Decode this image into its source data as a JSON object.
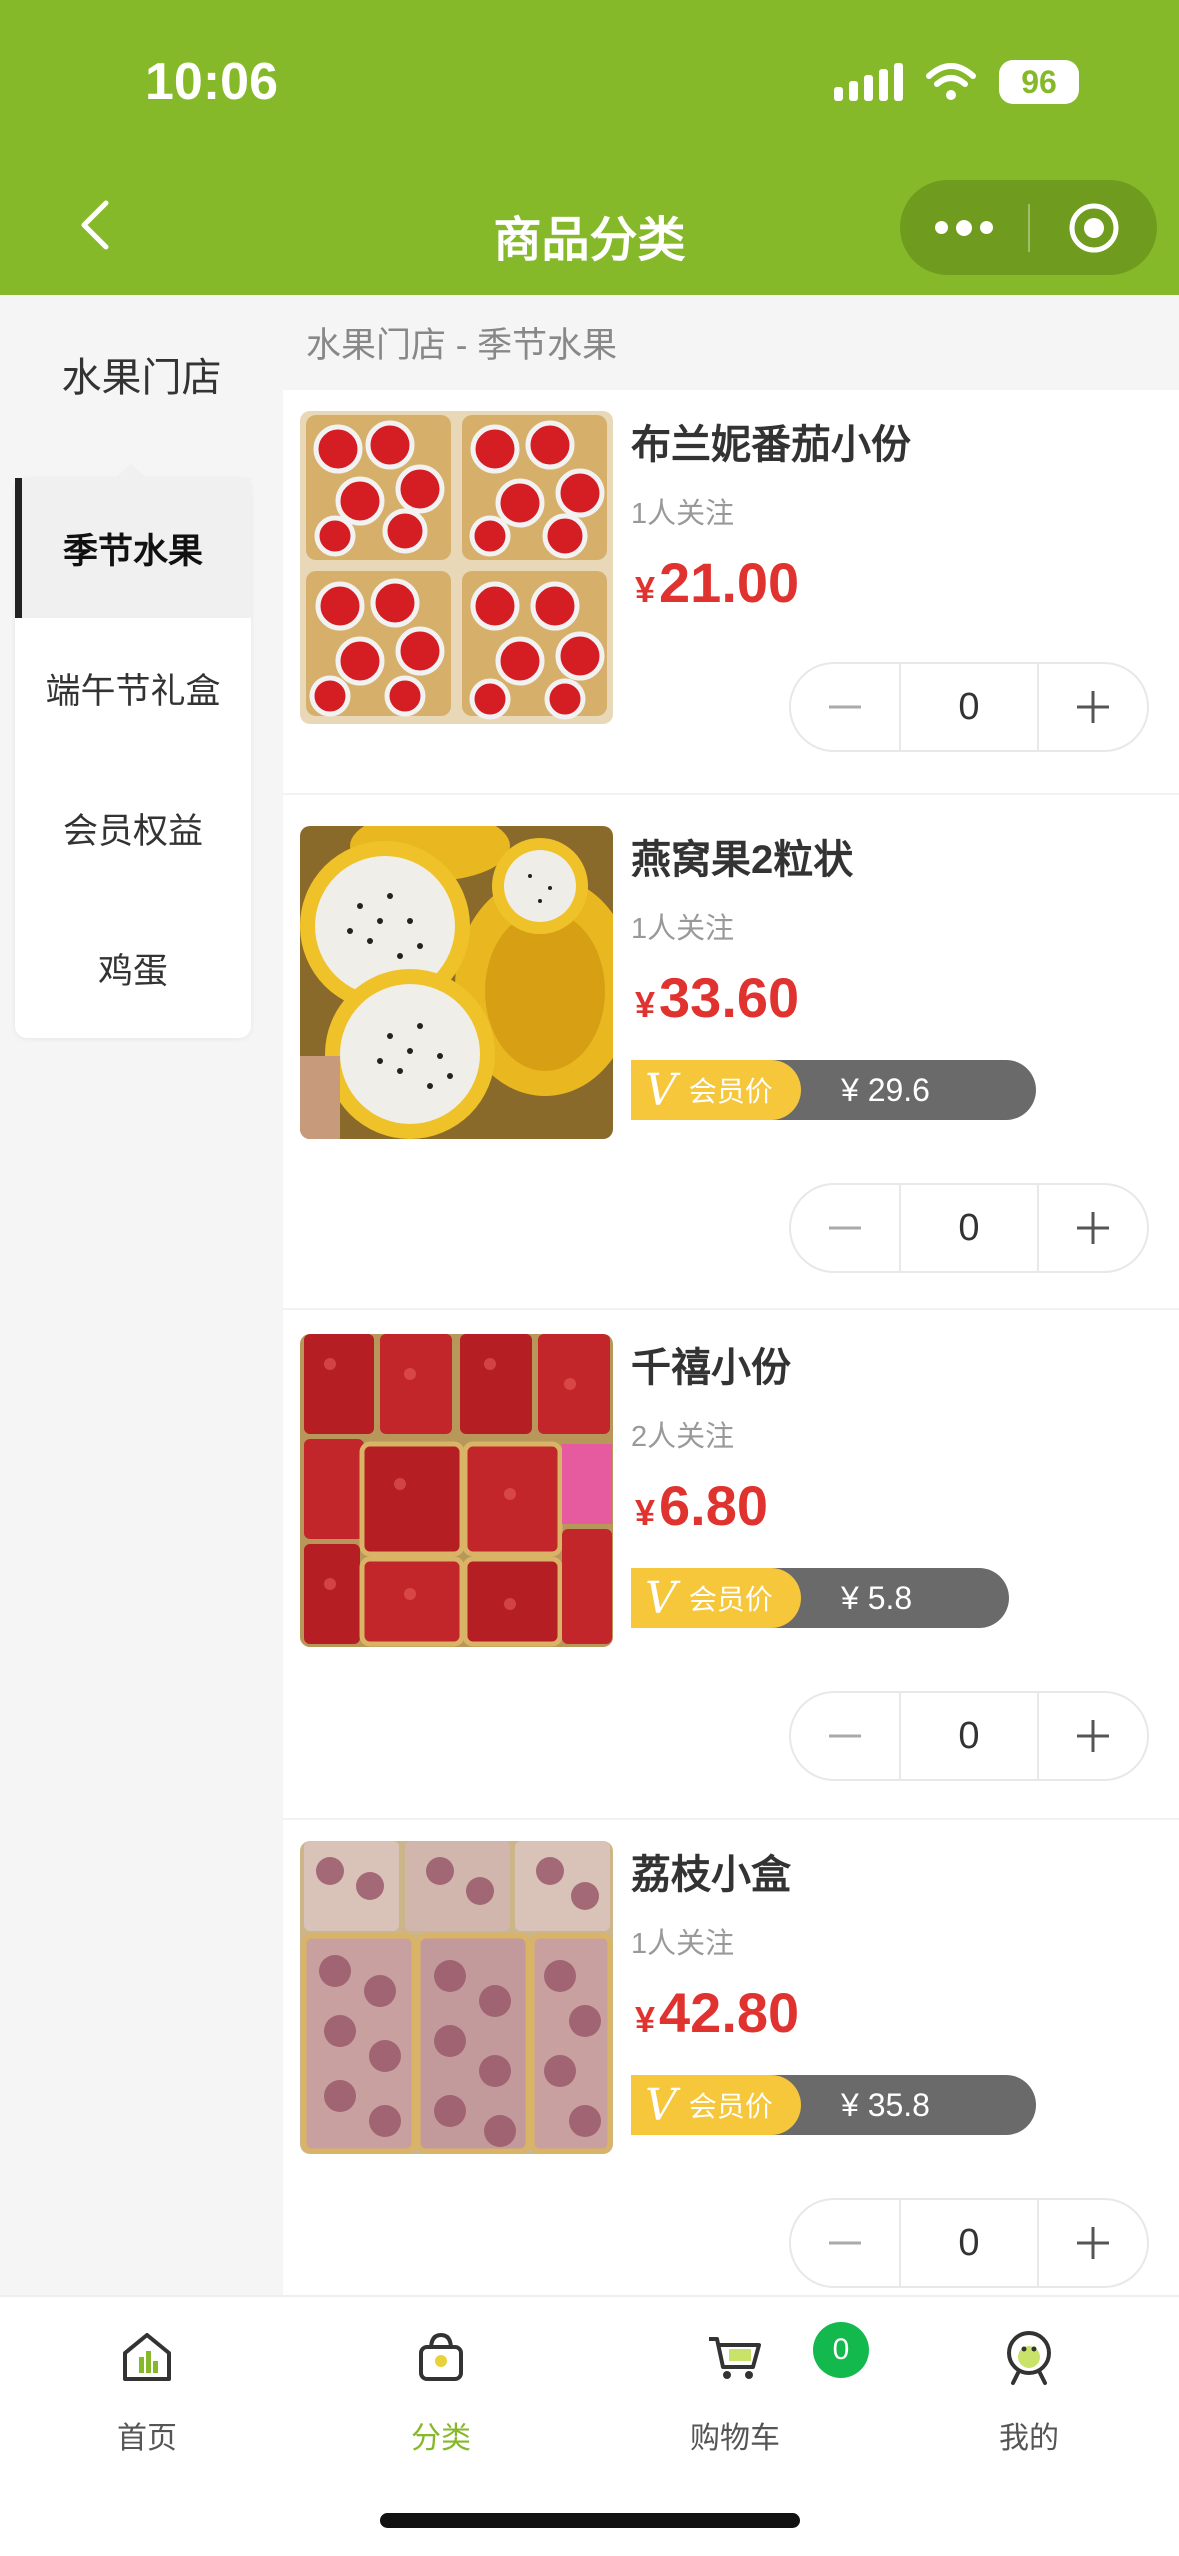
{
  "status_bar": {
    "time": "10:06",
    "battery": "96"
  },
  "nav": {
    "title": "商品分类"
  },
  "sidebar": {
    "store_name": "水果门店",
    "categories": [
      {
        "label": "季节水果",
        "active": true
      },
      {
        "label": "端午节礼盒",
        "active": false
      },
      {
        "label": "会员权益",
        "active": false
      },
      {
        "label": "鸡蛋",
        "active": false
      }
    ]
  },
  "breadcrumb": "水果门店 - 季节水果",
  "currency_symbol": "¥",
  "member_label": "会员价",
  "member_badge": "V",
  "products": [
    {
      "name": "布兰妮番茄小份",
      "watchers": "1人关注",
      "price": "21.00",
      "member_price": null,
      "quantity": "0"
    },
    {
      "name": "燕窝果2粒状",
      "watchers": "1人关注",
      "price": "33.60",
      "member_price": "¥ 29.6",
      "quantity": "0"
    },
    {
      "name": "千禧小份",
      "watchers": "2人关注",
      "price": "6.80",
      "member_price": "¥ 5.8",
      "quantity": "0"
    },
    {
      "name": "荔枝小盒",
      "watchers": "1人关注",
      "price": "42.80",
      "member_price": "¥ 35.8",
      "quantity": "0"
    }
  ],
  "tabbar": {
    "items": [
      {
        "label": "首页",
        "icon": "home-icon",
        "active": false
      },
      {
        "label": "分类",
        "icon": "bag-icon",
        "active": true
      },
      {
        "label": "购物车",
        "icon": "cart-icon",
        "active": false
      },
      {
        "label": "我的",
        "icon": "user-icon",
        "active": false
      }
    ],
    "cart_count": "0"
  },
  "colors": {
    "brand": "#86b92a",
    "price": "#e0322f",
    "member_tag": "#f6c63b",
    "badge": "#13b94d"
  }
}
